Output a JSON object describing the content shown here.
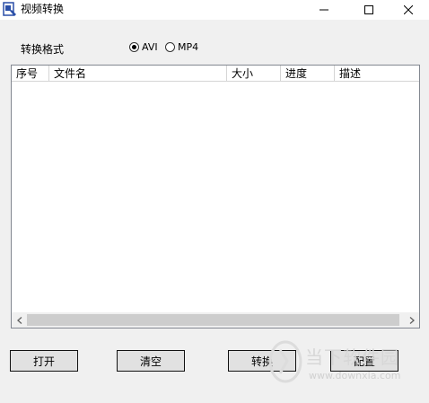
{
  "window": {
    "title": "视频转换"
  },
  "format": {
    "label": "转换格式",
    "options": [
      {
        "label": "AVI",
        "selected": true
      },
      {
        "label": "MP4",
        "selected": false
      }
    ]
  },
  "list": {
    "columns": [
      "序号",
      "文件名",
      "大小",
      "进度",
      "描述"
    ],
    "rows": []
  },
  "buttons": {
    "open": "打开",
    "clear": "清空",
    "convert": "转换",
    "config": "配置"
  },
  "watermark": {
    "text": "当下软件园",
    "url": "www.downxia.com"
  }
}
